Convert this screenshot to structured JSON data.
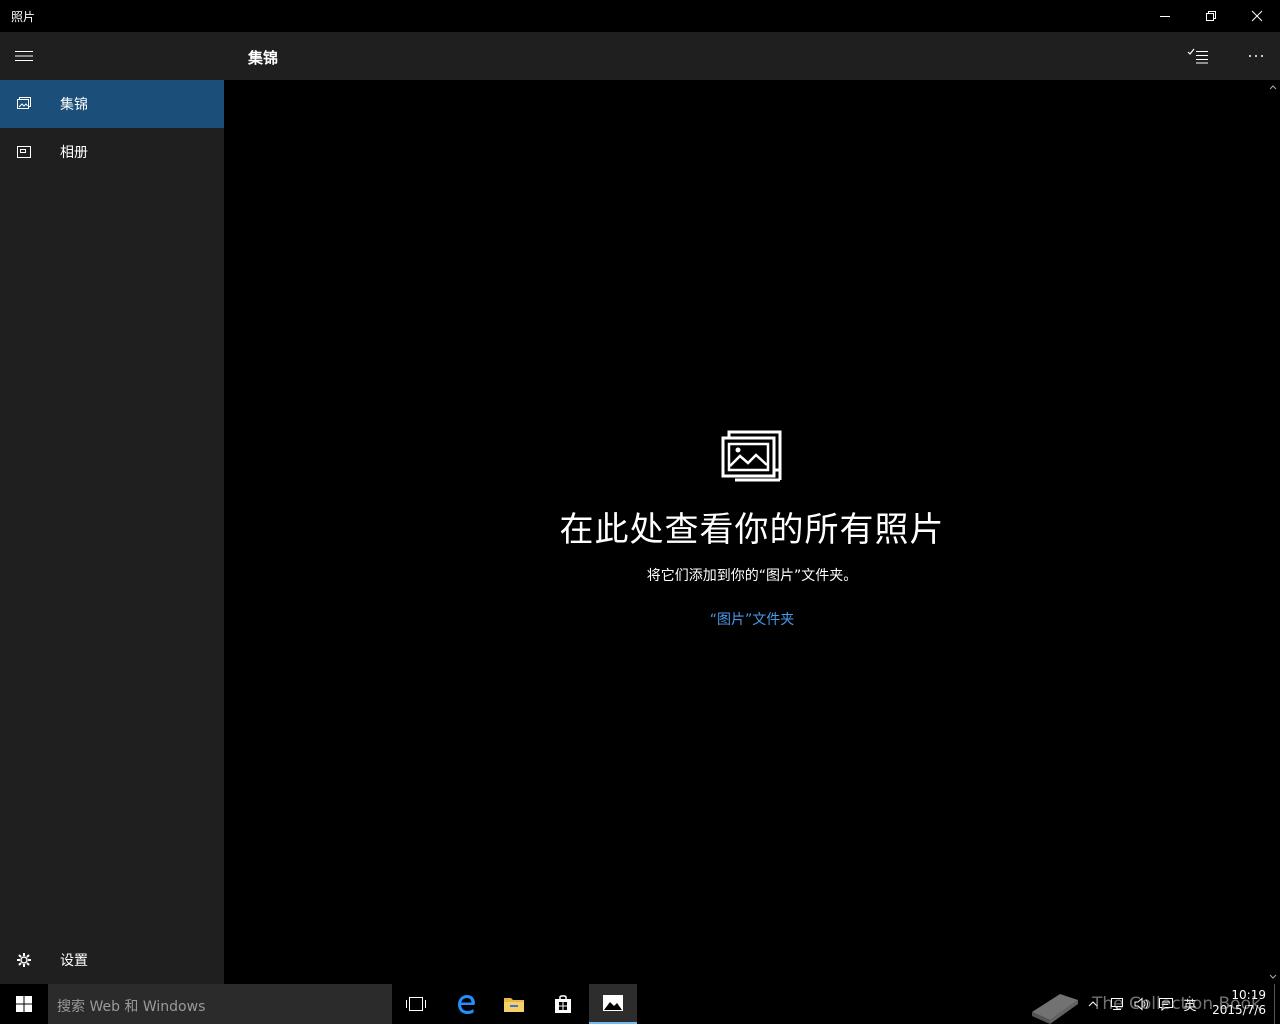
{
  "window": {
    "title": "照片",
    "minimize_icon": "minimize-icon",
    "restore_icon": "restore-icon",
    "close_icon": "close-icon"
  },
  "sidebar": {
    "menu_icon": "hamburger-icon",
    "items": [
      {
        "label": "集锦",
        "icon": "collection-icon",
        "active": true
      },
      {
        "label": "相册",
        "icon": "album-icon",
        "active": false
      }
    ],
    "settings": {
      "label": "设置",
      "icon": "gear-icon"
    }
  },
  "header": {
    "title": "集锦",
    "select_icon": "select-list-icon",
    "more_icon": "more-icon"
  },
  "empty_state": {
    "icon": "photos-stack-icon",
    "title": "在此处查看你的所有照片",
    "subtitle": "将它们添加到你的“图片”文件夹。",
    "link": "“图片”文件夹"
  },
  "taskbar": {
    "search_placeholder": "搜索 Web 和 Windows",
    "apps": [
      "task-view-icon",
      "edge-icon",
      "file-explorer-icon",
      "store-icon",
      "photos-icon"
    ],
    "tray": {
      "ime": "英",
      "time": "10:19",
      "date": "2015/7/6"
    }
  },
  "watermark": {
    "text": "The Collection Book"
  },
  "colors": {
    "accent": "#1c4e7a",
    "link": "#4a9ae8",
    "sidebar_bg": "#1f1f1f",
    "content_bg": "#000000"
  }
}
